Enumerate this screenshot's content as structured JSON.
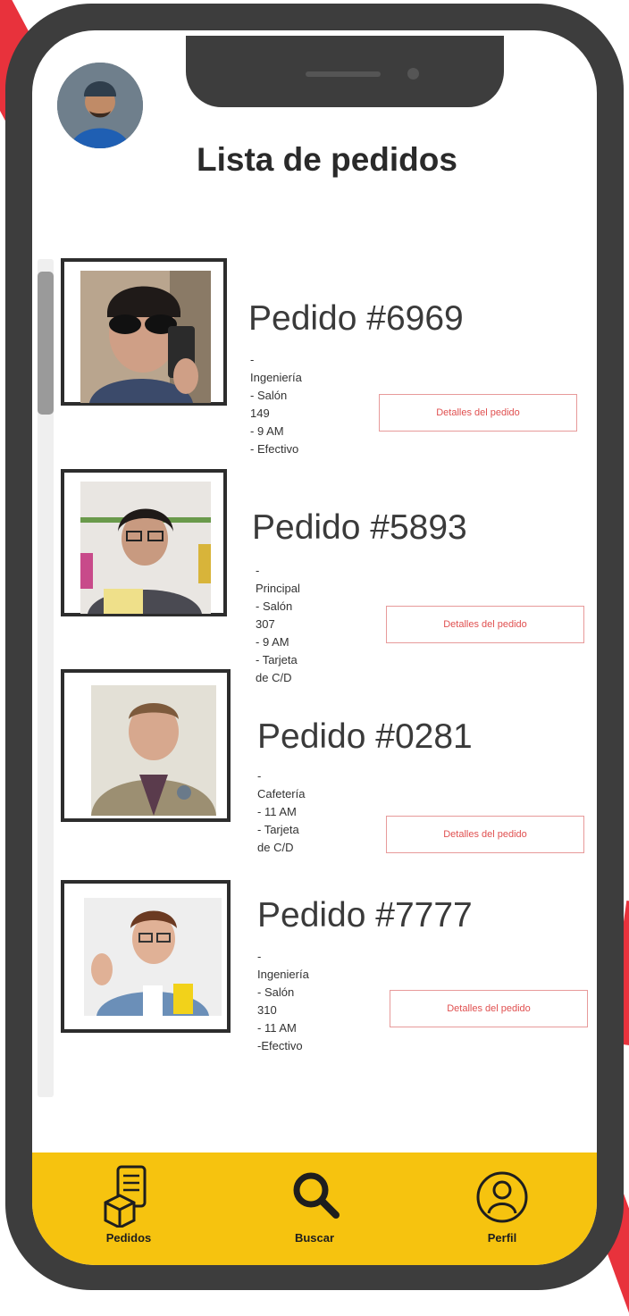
{
  "page": {
    "title": "Lista de pedidos"
  },
  "orders": [
    {
      "title": "Pedido #6969",
      "details": [
        "- Ingeniería",
        "- Salón 149",
        "- 9 AM",
        "- Efectivo"
      ],
      "button": "Detalles del pedido"
    },
    {
      "title": "Pedido #5893",
      "details": [
        "- Principal",
        "- Salón 307",
        "- 9 AM",
        "- Tarjeta de C/D"
      ],
      "button": "Detalles del pedido"
    },
    {
      "title": "Pedido #0281",
      "details": [
        "- Cafetería",
        "- 11 AM",
        "- Tarjeta de C/D"
      ],
      "button": "Detalles del pedido"
    },
    {
      "title": "Pedido #7777",
      "details": [
        "- Ingeniería",
        "- Salón 310",
        "- 11 AM",
        "-Efectivo"
      ],
      "button": "Detalles del pedido"
    }
  ],
  "nav": {
    "items": [
      {
        "label": "Pedidos",
        "icon": "orders-icon"
      },
      {
        "label": "Buscar",
        "icon": "search-icon"
      },
      {
        "label": "Perfil",
        "icon": "profile-icon"
      }
    ]
  },
  "colors": {
    "accent": "#f6c30f",
    "frame": "#3d3d3d",
    "button_border": "#e79a9a",
    "button_text": "#e05050",
    "corner_accent": "#e8323c"
  }
}
